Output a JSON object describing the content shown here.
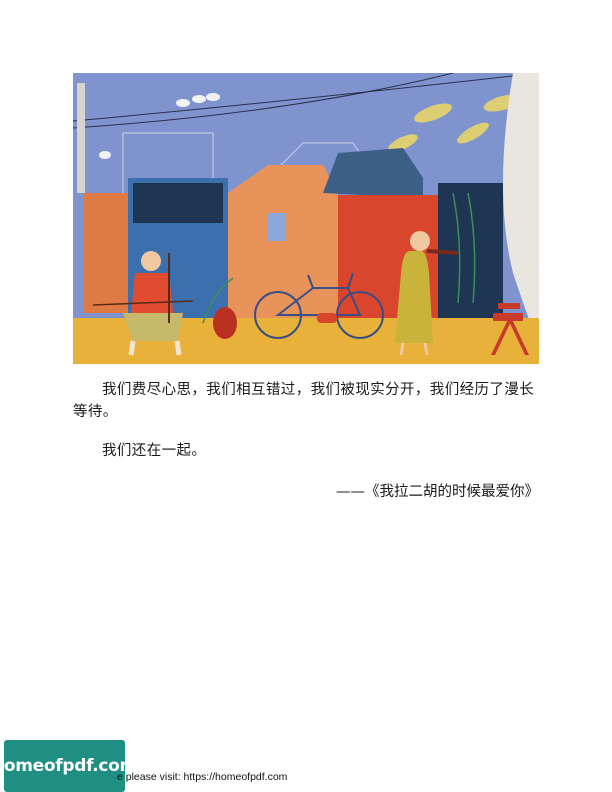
{
  "illustration": {
    "description_icon": "street-music-illustration-icon",
    "colors": {
      "sky": "#7f93cf",
      "ground": "#e8b23a",
      "orange_house": "#e07a44",
      "red_wall": "#d9452d",
      "dark_wall": "#1e3553",
      "shirt": "#e14b30",
      "dress": "#c9b33a"
    }
  },
  "body": {
    "paragraph_1": "我们费尽心思，我们相互错过，我们被现实分开，我们经历了漫长等待。",
    "paragraph_2": "我们还在一起。",
    "attribution": "——《我拉二胡的时候最爱你》"
  },
  "footer": {
    "logo_text": "homeofpdf.com",
    "visit_text": "e please visit: https://homeofpdf.com"
  }
}
